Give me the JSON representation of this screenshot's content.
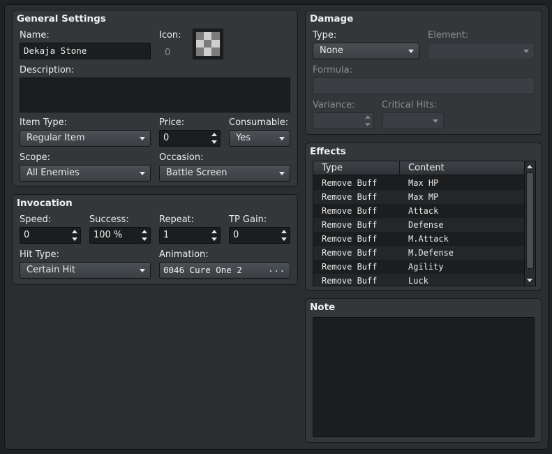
{
  "general": {
    "title": "General Settings",
    "name_label": "Name:",
    "name_value": "Dekaja Stone",
    "icon_label": "Icon:",
    "icon_index": "0",
    "description_label": "Description:",
    "description_value": "",
    "item_type_label": "Item Type:",
    "item_type_value": "Regular Item",
    "price_label": "Price:",
    "price_value": "0",
    "consumable_label": "Consumable:",
    "consumable_value": "Yes",
    "scope_label": "Scope:",
    "scope_value": "All Enemies",
    "occasion_label": "Occasion:",
    "occasion_value": "Battle Screen"
  },
  "invocation": {
    "title": "Invocation",
    "speed_label": "Speed:",
    "speed_value": "0",
    "success_label": "Success:",
    "success_value": "100 %",
    "repeat_label": "Repeat:",
    "repeat_value": "1",
    "tp_gain_label": "TP Gain:",
    "tp_gain_value": "0",
    "hit_type_label": "Hit Type:",
    "hit_type_value": "Certain Hit",
    "animation_label": "Animation:",
    "animation_value": "0046 Cure One 2",
    "animation_button": "..."
  },
  "damage": {
    "title": "Damage",
    "type_label": "Type:",
    "type_value": "None",
    "element_label": "Element:",
    "element_value": "",
    "formula_label": "Formula:",
    "formula_value": "",
    "variance_label": "Variance:",
    "variance_value": "",
    "critical_label": "Critical Hits:",
    "critical_value": ""
  },
  "effects": {
    "title": "Effects",
    "columns": [
      "Type",
      "Content"
    ],
    "rows": [
      {
        "type": "Remove Buff",
        "content": "Max HP"
      },
      {
        "type": "Remove Buff",
        "content": "Max MP"
      },
      {
        "type": "Remove Buff",
        "content": "Attack"
      },
      {
        "type": "Remove Buff",
        "content": "Defense"
      },
      {
        "type": "Remove Buff",
        "content": "M.Attack"
      },
      {
        "type": "Remove Buff",
        "content": "M.Defense"
      },
      {
        "type": "Remove Buff",
        "content": "Agility"
      },
      {
        "type": "Remove Buff",
        "content": "Luck"
      }
    ]
  },
  "note": {
    "title": "Note",
    "value": ""
  },
  "colors": {
    "background": "#2b2e31",
    "panel": "#33373a",
    "field": "#1b1d1f",
    "text": "#e6e6e6",
    "disabled_text": "#8a8e92"
  }
}
